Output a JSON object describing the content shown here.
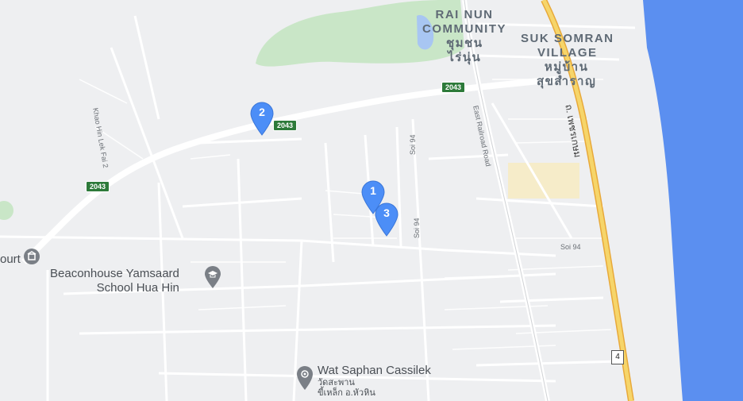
{
  "colors": {
    "background": "#eeeff1",
    "sea": "#5b8ff0",
    "park": "#c9e6c7",
    "water": "#a8c6f2",
    "highway": "#f6c744",
    "road": "#ffffff",
    "marker": "#4c8ef7",
    "shield": "#2d7a3a"
  },
  "areas": {
    "rai_nun_en": "RAI NUN\nCOMMUNITY",
    "rai_nun_th": "ชุมชน\nไร่นุ่น",
    "suk_somran_en": "SUK SOMRAN\nVILLAGE",
    "suk_somran_th": "หมู่บ้าน\nสุขสำราญ"
  },
  "roads": {
    "khao_hin_lek_fai": "Khao Hin Lek Fai 2",
    "soi94_vertical": "Soi 94",
    "soi94_lower": "Soi 94",
    "soi94_right": "Soi 94",
    "east_railroad": "East Railroad Road",
    "phetkasem_th": "ถ. เพชรเกษม"
  },
  "shields": {
    "r2043_a": "2043",
    "r2043_b": "2043",
    "r2043_c": "2043",
    "route4": "4"
  },
  "pois": {
    "beaconhouse": "Beaconhouse Yamsaard\nSchool Hua Hin",
    "wat_name": "Wat Saphan Cassilek",
    "wat_th": "วัดสะพาน\nขี้เหล็ก อ.หัวหิน",
    "court_partial": "ourt"
  },
  "markers": [
    {
      "label": "1",
      "icon": "map-pin-icon"
    },
    {
      "label": "2",
      "icon": "map-pin-icon"
    },
    {
      "label": "3",
      "icon": "map-pin-icon"
    }
  ]
}
